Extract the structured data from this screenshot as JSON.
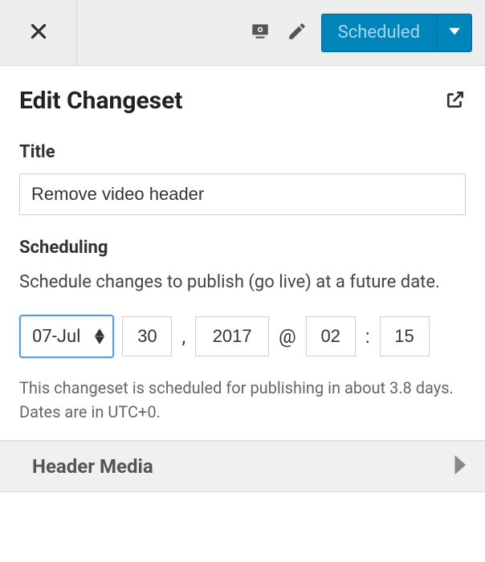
{
  "topbar": {
    "status_label": "Scheduled"
  },
  "panel": {
    "title": "Edit Changeset",
    "title_label": "Title",
    "title_value": "Remove video header",
    "scheduling_label": "Scheduling",
    "scheduling_desc": "Schedule changes to publish (go live) at a future date.",
    "month": "07-Jul",
    "day": "30",
    "year": "2017",
    "hour": "02",
    "minute": "15",
    "comma": ",",
    "at": "@",
    "colon": ":",
    "hint": "This changeset is scheduled for publishing in about 3.8 days. Dates are in UTC+0."
  },
  "sections": {
    "header_media": "Header Media"
  }
}
